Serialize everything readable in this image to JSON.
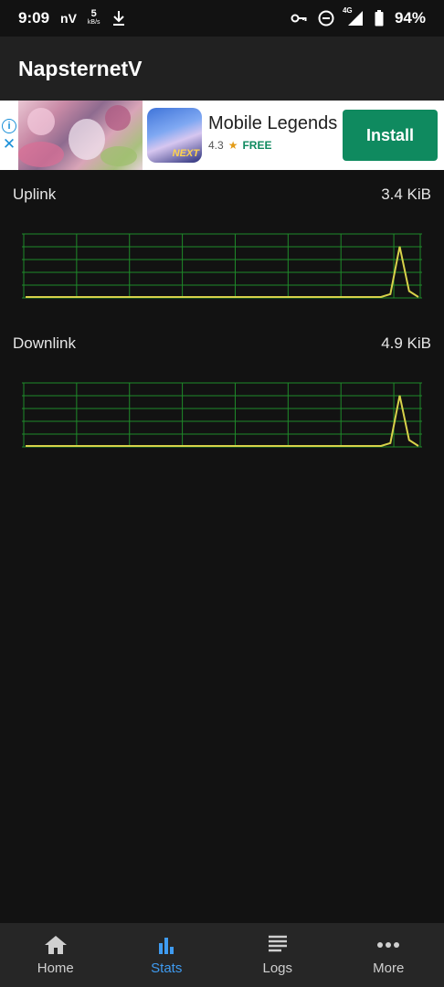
{
  "status_bar": {
    "time": "9:09",
    "carrier_tag": "nV",
    "net_speed_value": "5",
    "net_speed_unit": "kB/s",
    "network": "4G",
    "battery_percent": "94%",
    "icons": [
      "download-icon",
      "vpn-key-icon",
      "do-not-disturb-icon",
      "signal-icon",
      "battery-icon"
    ]
  },
  "app_bar": {
    "title": "NapsternetV"
  },
  "ad": {
    "app_name": "Mobile Legends",
    "rating": "4.3",
    "price": "FREE",
    "install_label": "Install",
    "icon_tag": "NEXT"
  },
  "stats": {
    "uplink": {
      "label": "Uplink",
      "value": "3.4 KiB",
      "level": [
        0,
        0,
        0,
        0,
        0,
        0,
        0,
        0,
        0,
        0,
        0,
        0,
        0,
        0,
        0,
        0,
        0,
        0,
        0,
        0,
        0,
        0,
        0,
        0,
        0,
        0,
        0,
        0,
        0,
        0,
        0,
        0,
        0,
        0,
        0,
        0,
        0,
        0,
        0,
        0.05,
        0.85,
        0.1,
        0
      ]
    },
    "downlink": {
      "label": "Downlink",
      "value": "4.9 KiB",
      "level": [
        0,
        0,
        0,
        0,
        0,
        0,
        0,
        0,
        0,
        0,
        0,
        0,
        0,
        0,
        0,
        0,
        0,
        0,
        0,
        0,
        0,
        0,
        0,
        0,
        0,
        0,
        0,
        0,
        0,
        0,
        0,
        0,
        0,
        0,
        0,
        0,
        0,
        0,
        0,
        0.05,
        0.85,
        0.1,
        0
      ]
    }
  },
  "bottom_nav": {
    "items": [
      {
        "label": "Home",
        "icon": "home-icon",
        "active": false
      },
      {
        "label": "Stats",
        "icon": "bar-chart-icon",
        "active": true
      },
      {
        "label": "Logs",
        "icon": "logs-icon",
        "active": false
      },
      {
        "label": "More",
        "icon": "more-icon",
        "active": false
      }
    ]
  },
  "colors": {
    "background": "#121212",
    "app_bar": "#212121",
    "graph_grid": "#1f8a2a",
    "graph_line": "#d8d24a",
    "accent": "#3f9bf0",
    "install_button": "#0f8a5f"
  }
}
